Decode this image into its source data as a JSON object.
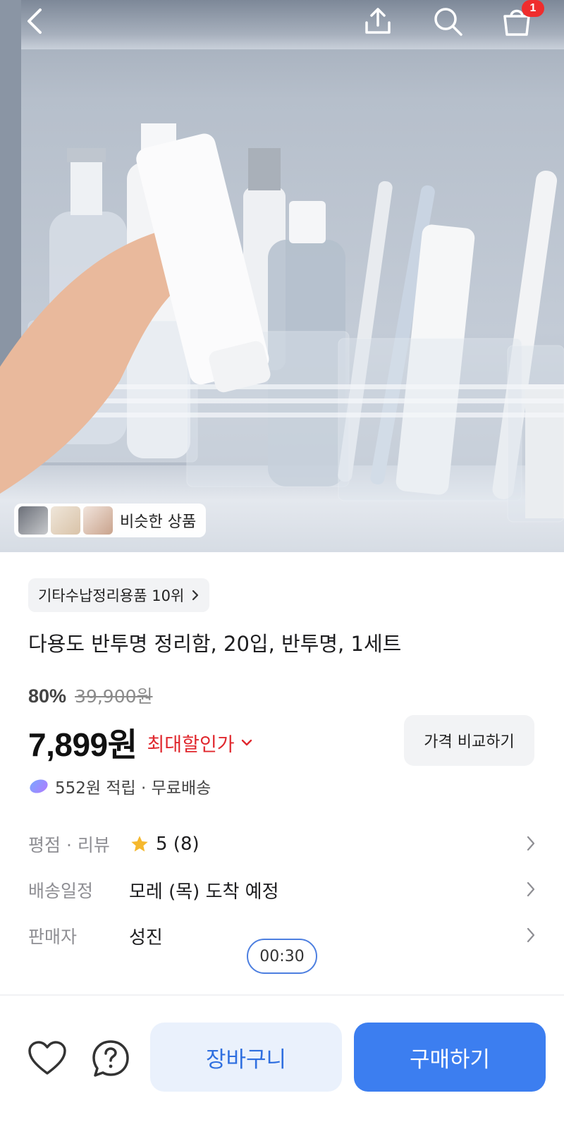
{
  "header": {
    "back_icon": "chevron-left-icon",
    "share_icon": "share-icon",
    "search_icon": "search-icon",
    "cart_icon": "shopping-bag-icon",
    "cart_count": "1"
  },
  "gallery": {
    "similar_label": "비슷한 상품"
  },
  "product": {
    "rank_label": "기타수납정리용품 10위",
    "title": "다용도 반투명 정리함, 20입, 반투명, 1세트",
    "discount_rate": "80%",
    "original_price": "39,900원",
    "price": "7,899원",
    "max_discount_label": "최대할인가",
    "compare_button": "가격 비교하기",
    "reward_text": "552원 적립 · 무료배송"
  },
  "details": {
    "rating_key": "평점 · 리뷰",
    "rating_value": "5 (8)",
    "shipping_key": "배송일정",
    "shipping_value": "모레 (목) 도착 예정",
    "seller_key": "판매자",
    "seller_value": "성진"
  },
  "timer": "00:30",
  "bottom_bar": {
    "wishlist_icon": "heart-icon",
    "inquiry_icon": "question-icon",
    "cart_button": "장바구니",
    "buy_button": "구매하기"
  },
  "colors": {
    "accent_blue": "#3c7ef0",
    "sale_red": "#e0282e",
    "badge_red": "#ef2d2d",
    "star": "#f5b82e"
  }
}
